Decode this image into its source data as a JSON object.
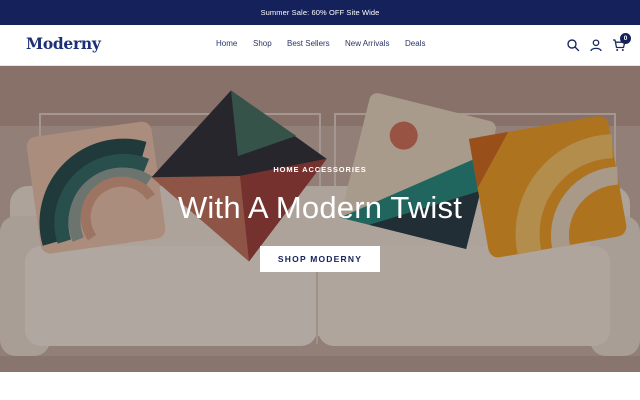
{
  "announcement": {
    "text": "Summer Sale: 60% OFF Site Wide"
  },
  "header": {
    "logo": "Moderny",
    "nav": [
      {
        "label": "Home"
      },
      {
        "label": "Shop"
      },
      {
        "label": "Best Sellers"
      },
      {
        "label": "New Arrivals"
      },
      {
        "label": "Deals"
      }
    ],
    "icons": [
      "search-icon",
      "account-icon",
      "cart-icon"
    ],
    "cart_count": "0"
  },
  "hero": {
    "eyebrow": "HOME ACCESSORIES",
    "headline": "With A Modern Twist",
    "cta_label": "SHOP MODERNY"
  },
  "colors": {
    "announcement_bg": "#14215a",
    "brand": "#1c2f78",
    "cta_bg": "#ffffff",
    "cta_text": "#14215a"
  }
}
